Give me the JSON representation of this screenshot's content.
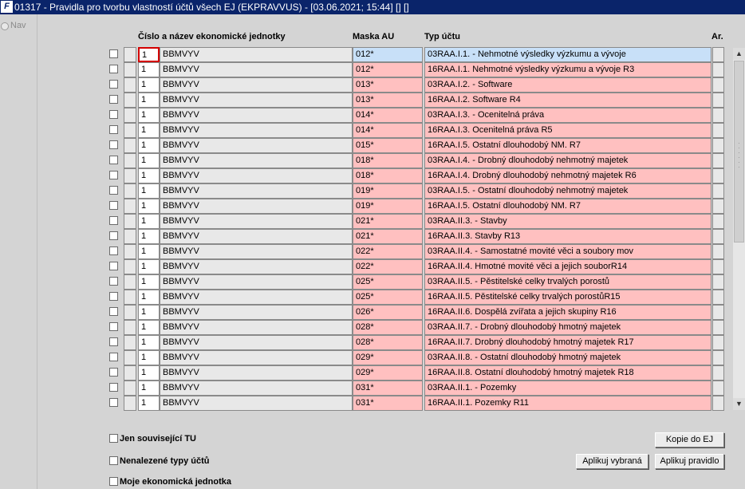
{
  "window": {
    "app_icon_text": "F",
    "title": "01317 - Pravidla pro tvorbu vlastností účtů všech EJ (EKPRAVVUS) - [03.06.2021; 15:44]  [] []"
  },
  "leftnav": {
    "label": "Nav"
  },
  "columns": {
    "unit": "Číslo a název ekonomické jednotky",
    "mask": "Maska AU",
    "type": "Typ účtu",
    "ar": "Ar."
  },
  "rows": [
    {
      "num": "1",
      "name": "BBMVYV",
      "mask": "012*",
      "type": "03RAA.I.1. - Nehmotné výsledky výzkumu a vývoje"
    },
    {
      "num": "1",
      "name": "BBMVYV",
      "mask": "012*",
      "type": "16RAA.I.1.  Nehmotné výsledky výzkumu a vývoje R3"
    },
    {
      "num": "1",
      "name": "BBMVYV",
      "mask": "013*",
      "type": "03RAA.I.2. - Software"
    },
    {
      "num": "1",
      "name": "BBMVYV",
      "mask": "013*",
      "type": "16RAA.I.2.  Software R4"
    },
    {
      "num": "1",
      "name": "BBMVYV",
      "mask": "014*",
      "type": "03RAA.I.3. - Ocenitelná práva"
    },
    {
      "num": "1",
      "name": "BBMVYV",
      "mask": "014*",
      "type": "16RAA.I.3.  Ocenitelná práva R5"
    },
    {
      "num": "1",
      "name": "BBMVYV",
      "mask": "015*",
      "type": "16RAA.I.5.  Ostatní dlouhodobý NM. R7"
    },
    {
      "num": "1",
      "name": "BBMVYV",
      "mask": "018*",
      "type": "03RAA.I.4. - Drobný dlouhodobý nehmotný majetek"
    },
    {
      "num": "1",
      "name": "BBMVYV",
      "mask": "018*",
      "type": "16RAA.I.4.  Drobný dlouhodobý nehmotný majetek R6"
    },
    {
      "num": "1",
      "name": "BBMVYV",
      "mask": "019*",
      "type": "03RAA.I.5. - Ostatní dlouhodobý nehmotný majetek"
    },
    {
      "num": "1",
      "name": "BBMVYV",
      "mask": "019*",
      "type": "16RAA.I.5.  Ostatní dlouhodobý NM. R7"
    },
    {
      "num": "1",
      "name": "BBMVYV",
      "mask": "021*",
      "type": "03RAA.II.3. - Stavby"
    },
    {
      "num": "1",
      "name": "BBMVYV",
      "mask": "021*",
      "type": "16RAA.II.3.  Stavby R13"
    },
    {
      "num": "1",
      "name": "BBMVYV",
      "mask": "022*",
      "type": "03RAA.II.4. - Samostatné movité věci a soubory mov"
    },
    {
      "num": "1",
      "name": "BBMVYV",
      "mask": "022*",
      "type": "16RAA.II.4.  Hmotné movité věci a jejich souborR14"
    },
    {
      "num": "1",
      "name": "BBMVYV",
      "mask": "025*",
      "type": "03RAA.II.5. - Pěstitelské celky trvalých porostů"
    },
    {
      "num": "1",
      "name": "BBMVYV",
      "mask": "025*",
      "type": "16RAA.II.5.  Pěstitelské celky trvalých porostůR15"
    },
    {
      "num": "1",
      "name": "BBMVYV",
      "mask": "026*",
      "type": "16RAA.II.6.  Dospělá zvířata a jejich skupiny R16"
    },
    {
      "num": "1",
      "name": "BBMVYV",
      "mask": "028*",
      "type": "03RAA.II.7. - Drobný dlouhodobý hmotný majetek"
    },
    {
      "num": "1",
      "name": "BBMVYV",
      "mask": "028*",
      "type": "16RAA.II.7.  Drobný dlouhodobý hmotný majetek R17"
    },
    {
      "num": "1",
      "name": "BBMVYV",
      "mask": "029*",
      "type": "03RAA.II.8. - Ostatní dlouhodobý hmotný majetek"
    },
    {
      "num": "1",
      "name": "BBMVYV",
      "mask": "029*",
      "type": "16RAA.II.8.  Ostatní dlouhodobý hmotný majetek R18"
    },
    {
      "num": "1",
      "name": "BBMVYV",
      "mask": "031*",
      "type": "03RAA.II.1. - Pozemky"
    },
    {
      "num": "1",
      "name": "BBMVYV",
      "mask": "031*",
      "type": "16RAA.II.1.  Pozemky R11"
    }
  ],
  "options": {
    "related_only": "Jen související TU",
    "not_found_types": "Nenalezené  typy účtů",
    "my_unit": "Moje ekonomická jednotka"
  },
  "buttons": {
    "copy_to_ej": "Kopie do EJ",
    "apply_selected": "Aplikuj vybraná",
    "apply_rule": "Aplikuj pravidlo"
  },
  "colors": {
    "titlebar": "#0a246a",
    "type_cell": "#ffc0c0",
    "active_row": "#c8e0f8",
    "active_border": "#d40000"
  }
}
